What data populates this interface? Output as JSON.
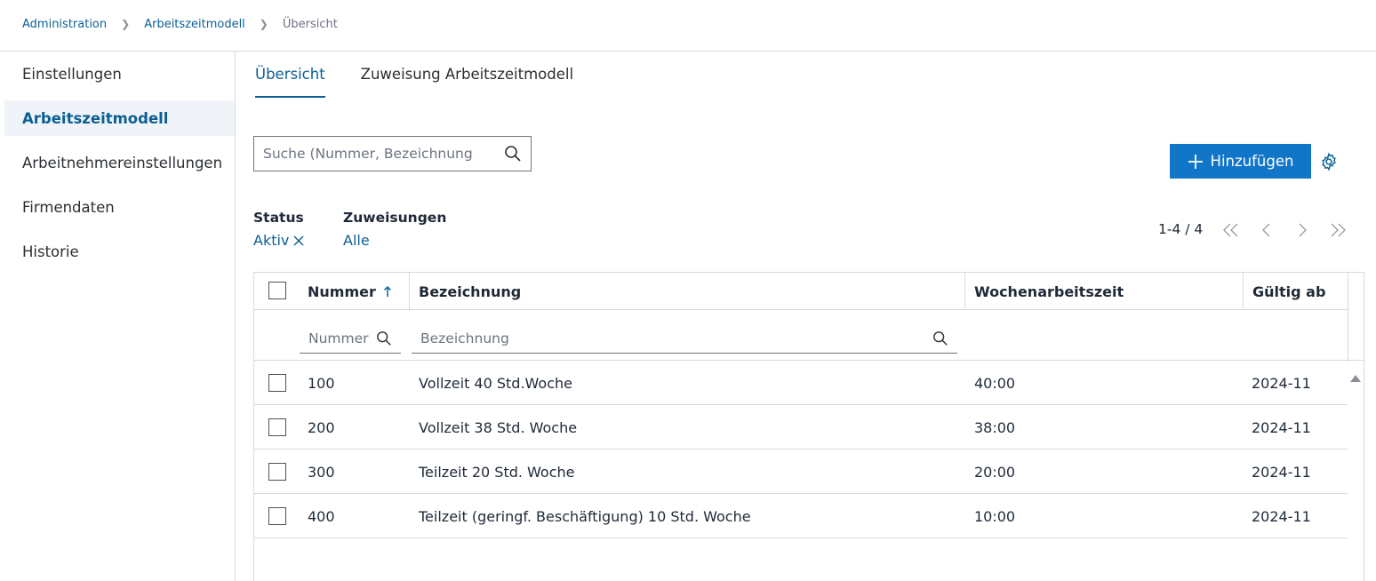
{
  "breadcrumb": {
    "items": [
      "Administration",
      "Arbeitszeitmodell"
    ],
    "current": "Übersicht"
  },
  "sidebar": {
    "items": [
      {
        "label": "Einstellungen"
      },
      {
        "label": "Arbeitszeitmodell"
      },
      {
        "label": "Arbeitnehmereinstellungen"
      },
      {
        "label": "Firmendaten"
      },
      {
        "label": "Historie"
      }
    ],
    "active_index": 1
  },
  "tabs": [
    {
      "label": "Übersicht"
    },
    {
      "label": "Zuweisung Arbeitszeitmodell"
    }
  ],
  "search": {
    "placeholder": "Suche (Nummer, Bezeichnung",
    "value": ""
  },
  "toolbar": {
    "add_label": "Hinzufügen"
  },
  "filters": {
    "status_label": "Status",
    "status_value": "Aktiv",
    "zuweisungen_label": "Zuweisungen",
    "zuweisungen_value": "Alle"
  },
  "pagination": {
    "info": "1-4 / 4"
  },
  "table": {
    "columns": [
      "Nummer",
      "Bezeichnung",
      "Wochenarbeitszeit",
      "Gültig ab"
    ],
    "sort": {
      "column": "Nummer",
      "direction": "ascending"
    },
    "column_filters": {
      "nummer_placeholder": "Nummer",
      "bezeichnung_placeholder": "Bezeichnung"
    },
    "rows": [
      {
        "nummer": "100",
        "bezeichnung": "Vollzeit 40 Std.Woche",
        "wochenarbeitszeit": "40:00",
        "gueltig_ab": "2024-11"
      },
      {
        "nummer": "200",
        "bezeichnung": "Vollzeit 38 Std. Woche",
        "wochenarbeitszeit": "38:00",
        "gueltig_ab": "2024-11"
      },
      {
        "nummer": "300",
        "bezeichnung": "Teilzeit 20 Std. Woche",
        "wochenarbeitszeit": "20:00",
        "gueltig_ab": "2024-11"
      },
      {
        "nummer": "400",
        "bezeichnung": "Teilzeit (geringf. Beschäftigung) 10 Std. Woche",
        "wochenarbeitszeit": "10:00",
        "gueltig_ab": "2024-11"
      }
    ]
  },
  "colors": {
    "accent": "#0b5f94",
    "primary_button": "#1175c8",
    "active_sidebar_bg": "#f0f4f8",
    "border": "#d6d9dd"
  },
  "icons": [
    "chevron-right-icon",
    "search-icon",
    "plus-icon",
    "gear-icon",
    "close-icon",
    "first-page-icon",
    "previous-page-icon",
    "next-page-icon",
    "last-page-icon",
    "sort-ascending-icon",
    "scroll-up-icon"
  ]
}
